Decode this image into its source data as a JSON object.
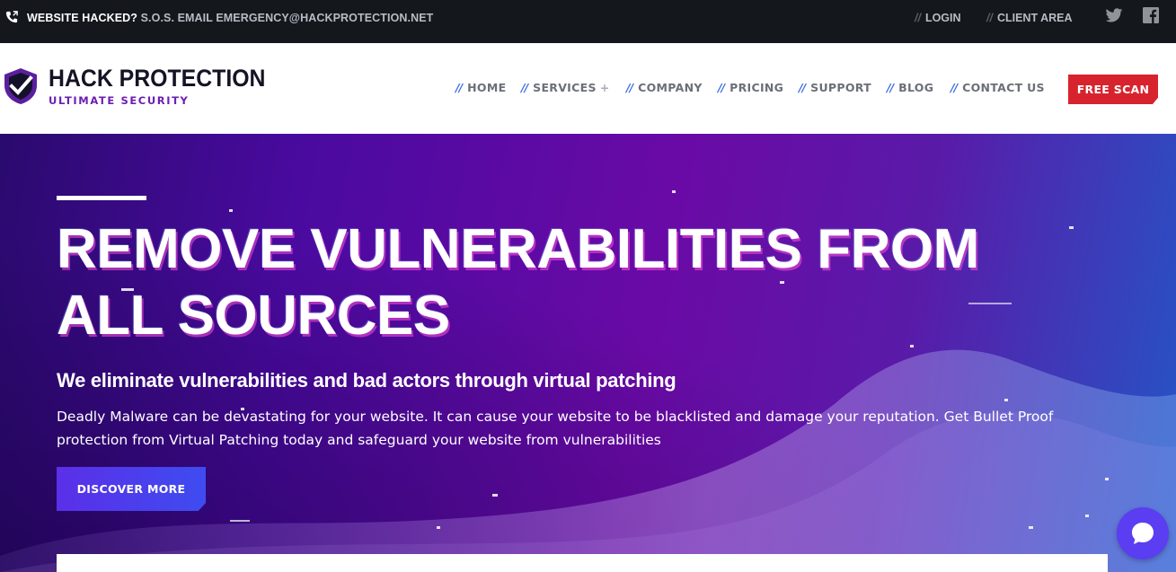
{
  "topbar": {
    "alert_highlight": "WEBSITE HACKED?",
    "alert_text": "S.O.S. EMAIL EMERGENCY@HACKPROTECTION.NET",
    "login": "LOGIN",
    "client_area": "CLIENT AREA",
    "separator": "//",
    "icons": [
      "phone-icon",
      "twitter-icon",
      "facebook-icon"
    ]
  },
  "header": {
    "logo_title": "HACK PROTECTION",
    "logo_subtitle": "ULTIMATE SECURITY",
    "nav_separator": "//",
    "nav": [
      {
        "label": "HOME"
      },
      {
        "label": "SERVICES",
        "has_submenu": true,
        "submenu_icon": "+"
      },
      {
        "label": "COMPANY"
      },
      {
        "label": "PRICING"
      },
      {
        "label": "SUPPORT"
      },
      {
        "label": "BLOG"
      },
      {
        "label": "CONTACT US"
      }
    ],
    "cta": "FREE SCAN"
  },
  "hero": {
    "title": "REMOVE VULNERABILITIES FROM ALL SOURCES",
    "subtitle": "We eliminate vulnerabilities and bad actors through virtual patching",
    "description": "Deadly Malware can be devastating for your website. It can cause your website to be blacklisted and damage your reputation. Get Bullet Proof protection from Virtual Patching today and safeguard your website from vulnerabilities",
    "button": "DISCOVER MORE"
  },
  "chat": {
    "icon": "chat-bubble-icon"
  },
  "colors": {
    "topbar_bg": "#14181d",
    "brand_purple": "#6b1fb3",
    "nav_slash": "#3f6fe0",
    "cta_red": "#d7232d",
    "button_blue": "#4a3fec",
    "chat_bg": "#5b3df2"
  }
}
